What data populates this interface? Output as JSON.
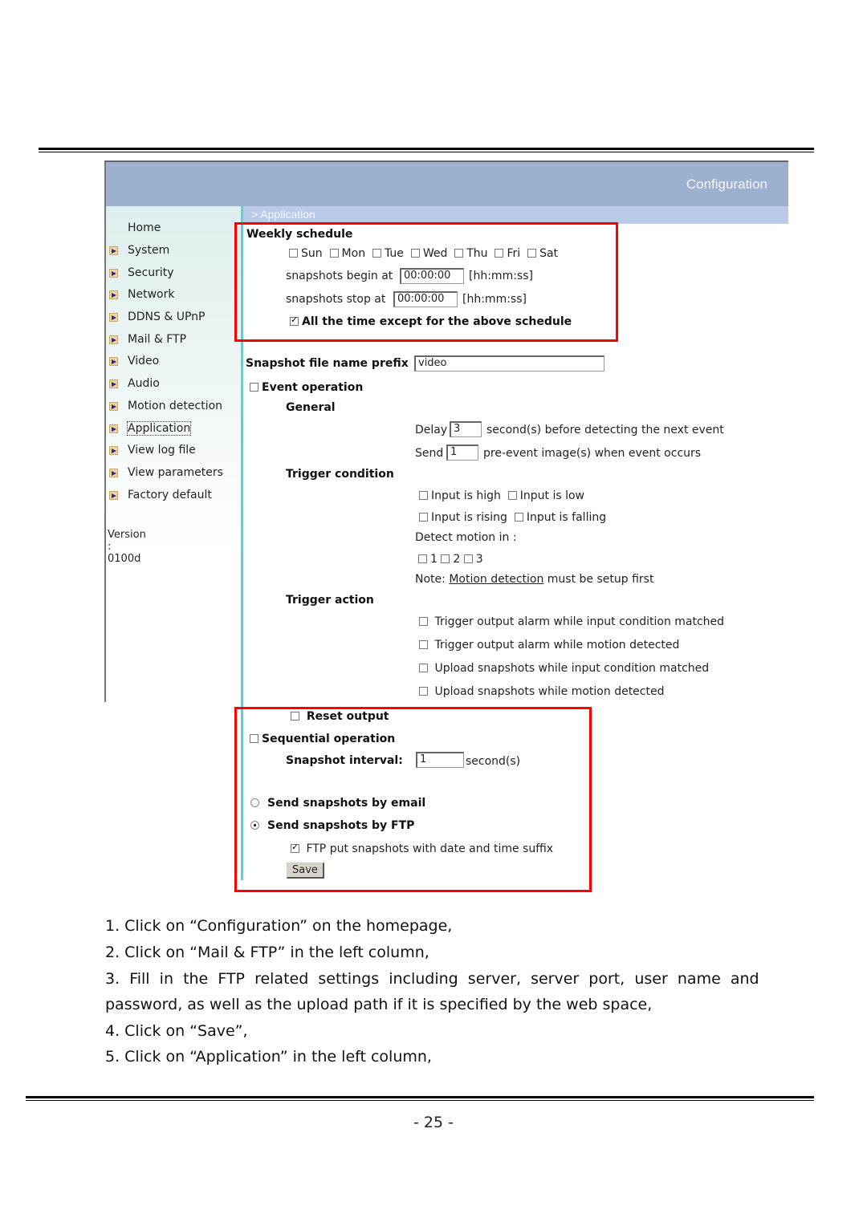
{
  "screenshot": {
    "header_title": "Configuration",
    "breadcrumb": "> Application",
    "sidebar": {
      "items": [
        {
          "label": "Home",
          "has_arrow": false
        },
        {
          "label": "System",
          "has_arrow": true
        },
        {
          "label": "Security",
          "has_arrow": true
        },
        {
          "label": "Network",
          "has_arrow": true
        },
        {
          "label": "DDNS & UPnP",
          "has_arrow": true
        },
        {
          "label": "Mail & FTP",
          "has_arrow": true
        },
        {
          "label": "Video",
          "has_arrow": true
        },
        {
          "label": "Audio",
          "has_arrow": true
        },
        {
          "label": "Motion detection",
          "has_arrow": true
        },
        {
          "label": "Application",
          "has_arrow": true,
          "active": true
        },
        {
          "label": "View log file",
          "has_arrow": true
        },
        {
          "label": "View parameters",
          "has_arrow": true
        },
        {
          "label": "Factory default",
          "has_arrow": true
        }
      ],
      "version": "Version : 0100d"
    },
    "weekly_schedule": {
      "title": "Weekly schedule",
      "days": [
        {
          "label": "Sun",
          "checked": false
        },
        {
          "label": "Mon",
          "checked": false
        },
        {
          "label": "Tue",
          "checked": false
        },
        {
          "label": "Wed",
          "checked": false
        },
        {
          "label": "Thu",
          "checked": false
        },
        {
          "label": "Fri",
          "checked": false
        },
        {
          "label": "Sat",
          "checked": false
        }
      ],
      "begin_label": "snapshots begin at",
      "begin_value": "00:00:00",
      "stop_label": "snapshots stop at",
      "stop_value": "00:00:00",
      "format_hint": "[hh:mm:ss]",
      "except_label": "All the time except for the above schedule",
      "except_checked": true
    },
    "prefix": {
      "label": "Snapshot file name prefix",
      "value": "video"
    },
    "event_operation": {
      "label": "Event operation",
      "checked": false,
      "general_title": "General",
      "delay_label": "Delay",
      "delay_value": "3",
      "delay_suffix": "second(s) before detecting the next event",
      "send_label": "Send",
      "send_value": "1",
      "send_suffix": "pre-event image(s) when event occurs",
      "trigger_condition_title": "Trigger condition",
      "conditions": [
        {
          "label": "Input is high",
          "checked": false
        },
        {
          "label": "Input is low",
          "checked": false
        },
        {
          "label": "Input is rising",
          "checked": false
        },
        {
          "label": "Input is falling",
          "checked": false
        }
      ],
      "detect_motion_label": "Detect motion in :",
      "motion_windows": [
        {
          "label": "1",
          "checked": false
        },
        {
          "label": "2",
          "checked": false
        },
        {
          "label": "3",
          "checked": false
        }
      ],
      "note_prefix": "Note:",
      "note_link": "Motion detection",
      "note_suffix": "must be setup first",
      "trigger_action_title": "Trigger action",
      "actions": [
        {
          "label": "Trigger output alarm while input condition matched",
          "checked": false
        },
        {
          "label": "Trigger output alarm while motion detected",
          "checked": false
        },
        {
          "label": "Upload snapshots while input condition matched",
          "checked": false
        },
        {
          "label": "Upload snapshots while motion detected",
          "checked": false
        }
      ],
      "reset_output_label": "Reset output",
      "reset_output_checked": false
    },
    "sequential_operation": {
      "label": "Sequential operation",
      "checked": false,
      "interval_label": "Snapshot interval:",
      "interval_value": "1",
      "interval_suffix": "second(s)"
    },
    "send_method": {
      "email_label": "Send snapshots by email",
      "email_selected": false,
      "ftp_label": "Send snapshots by FTP",
      "ftp_selected": true,
      "ftp_suffix_label": "FTP put snapshots with date and time suffix",
      "ftp_suffix_checked": true
    },
    "save_label": "Save"
  },
  "instructions": [
    "1. Click on “Configuration” on the homepage,",
    "2. Click on “Mail & FTP” in the left column,",
    "3.  Fill  in  the  FTP  related  settings  including  server,  server  port,  user  name  and",
    "password, as well as the upload path if it is specified by the web space,",
    "4. Click on “Save”,",
    "5. Click on “Application” in the left column,"
  ],
  "page_number": "- 25 -",
  "colors": {
    "highlight_box": "#ff0000",
    "header_bg": "#9eb0cf",
    "breadcrumb_bg": "#b9cbe8",
    "sidebar_separator": "#7cc2c6"
  }
}
